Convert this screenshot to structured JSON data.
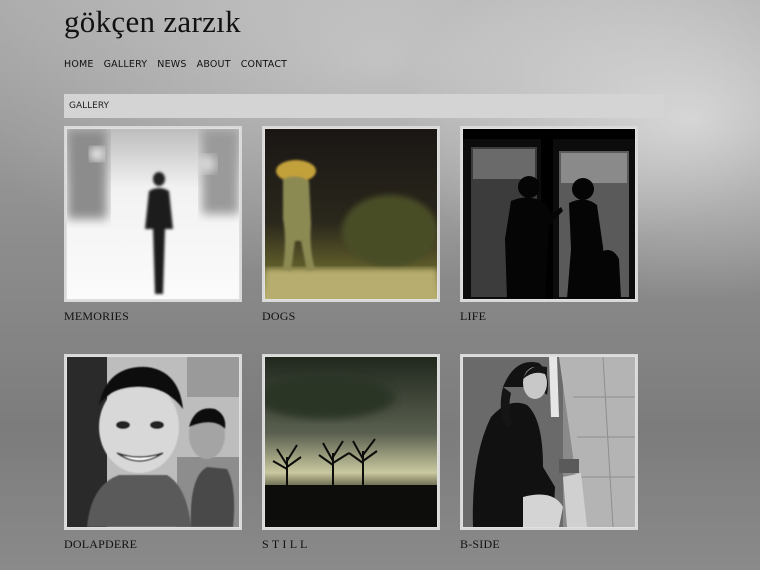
{
  "site": {
    "title": "gökçen zarzık"
  },
  "nav": [
    "HOME",
    "GALLERY",
    "NEWS",
    "ABOUT",
    "CONTACT"
  ],
  "section": {
    "label": "GALLERY"
  },
  "gallery": [
    {
      "caption": "MEMORIES",
      "image": "memories-photo"
    },
    {
      "caption": "DOGS",
      "image": "dogs-photo"
    },
    {
      "caption": "LIFE",
      "image": "life-photo"
    },
    {
      "caption": "DOLAPDERE",
      "image": "dolapdere-photo"
    },
    {
      "caption": "S T I L L",
      "image": "still-photo"
    },
    {
      "caption": "B-SIDE",
      "image": "b-side-photo"
    }
  ]
}
